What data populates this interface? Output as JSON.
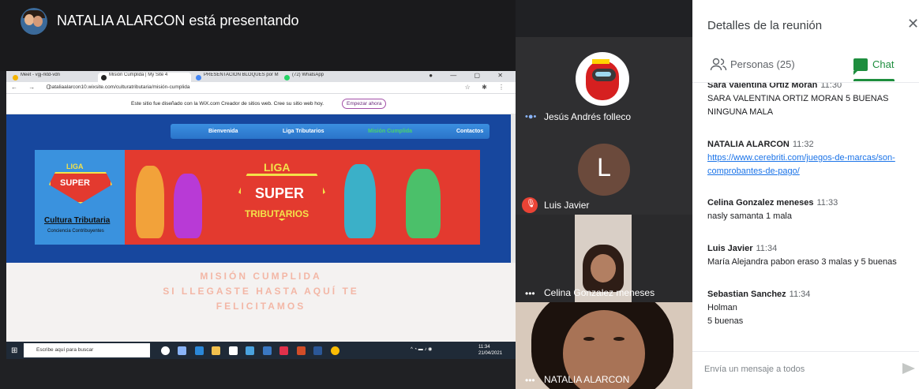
{
  "presenter": {
    "title": "NATALIA ALARCON está presentando"
  },
  "shared_screen": {
    "tabs": [
      {
        "label": "Meet - vgj-rktd-vdn",
        "color": "#f4b400"
      },
      {
        "label": "Misión Cumplida | My Site 4",
        "color": "#222222"
      },
      {
        "label": "PRESENTACIÓN BLOQUES por M",
        "color": "#4285f4"
      },
      {
        "label": "(72) WhatsApp",
        "color": "#25d366"
      }
    ],
    "url": "nataliaalarcon10.wixsite.com/culturatributaria/misión-cumplida",
    "wix_banner": "Este sitio fue diseñado con la WiX.com Creador de sitios web. Cree su sitio web hoy.",
    "wix_button": "Empezar ahora",
    "site_nav": [
      "Bienvenida",
      "Liga Tributarios",
      "Misión Cumplida",
      "Contactos"
    ],
    "banner": {
      "liga": "LIGA",
      "super": "SUPER",
      "tributarios": "TRIBUTARIOS",
      "cultura": "Cultura Tributaria",
      "conciencia": "Conciencia Contribuyentes"
    },
    "mision_lines": [
      "MISIÓN CUMPLIDA",
      "SI LLEGASTE HASTA AQUÍ TE",
      "FELICITAMOS"
    ],
    "taskbar": {
      "search_placeholder": "Escribe aquí para buscar",
      "time": "11:34",
      "date": "21/04/2021"
    }
  },
  "tiles": [
    {
      "name": "Jesús Andrés folleco",
      "indicator": "•●•",
      "avatar_type": "image"
    },
    {
      "name": "Luis Javier",
      "avatar_letter": "L",
      "muted": true
    },
    {
      "name": "Celina Gonzalez meneses",
      "indicator": "•••"
    },
    {
      "name": "NATALIA ALARCON",
      "indicator": "•••"
    }
  ],
  "sidebar": {
    "title": "Detalles de la reunión",
    "people_tab": "Personas (25)",
    "chat_tab": "Chat",
    "compose_placeholder": "Envía un mensaje a todos",
    "messages": [
      {
        "sender": "Sara Valentina Ortiz Moran",
        "time": "11:30",
        "lines": [
          "SARA VALENTINA ORTIZ MORAN 5 BUENAS",
          "NINGUNA MALA"
        ]
      },
      {
        "sender": "NATALIA ALARCON",
        "time": "11:32",
        "links": [
          "https://www.cerebriti.com/juegos-de-marcas/son-",
          "comprobantes-de-pago/"
        ]
      },
      {
        "sender": "Celina Gonzalez meneses",
        "time": "11:33",
        "lines": [
          "nasly samanta 1 mala"
        ]
      },
      {
        "sender": "Luis Javier",
        "time": "11:34",
        "lines": [
          "María Alejandra pabon eraso  3 malas y 5 buenas"
        ]
      },
      {
        "sender": "Sebastian Sanchez",
        "time": "11:34",
        "lines": [
          "Holman",
          "5 buenas"
        ]
      }
    ]
  }
}
